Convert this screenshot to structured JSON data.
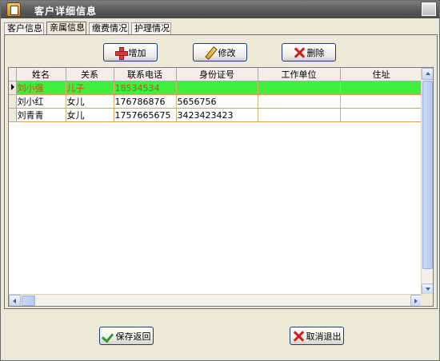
{
  "window": {
    "title": "客户详细信息"
  },
  "tabs": [
    {
      "label": "客户信息",
      "active": false
    },
    {
      "label": "亲属信息",
      "active": true
    },
    {
      "label": "缴费情况",
      "active": false
    },
    {
      "label": "护理情况",
      "active": false
    }
  ],
  "toolbar": {
    "add_label": "增加",
    "add_icon": "plus-icon",
    "edit_label": "修改",
    "edit_icon": "pencil-icon",
    "delete_label": "删除",
    "delete_icon": "x-icon"
  },
  "grid": {
    "columns": [
      "姓名",
      "关系",
      "联系电话",
      "身份证号",
      "工作单位",
      "住址"
    ],
    "rows": [
      {
        "selected": true,
        "cells": [
          "刘小强",
          "儿子",
          "18534534",
          "",
          "",
          ""
        ]
      },
      {
        "selected": false,
        "cells": [
          "刘小红",
          "女儿",
          "176786876",
          "5656756",
          "",
          ""
        ]
      },
      {
        "selected": false,
        "cells": [
          "刘青青",
          "女儿",
          "1757665675",
          "3423423423",
          "",
          ""
        ]
      }
    ],
    "selected_row_color": "#3cf03c"
  },
  "footer": {
    "save_label": "保存返回",
    "save_icon": "check-icon",
    "cancel_label": "取消退出",
    "cancel_icon": "x-icon"
  }
}
